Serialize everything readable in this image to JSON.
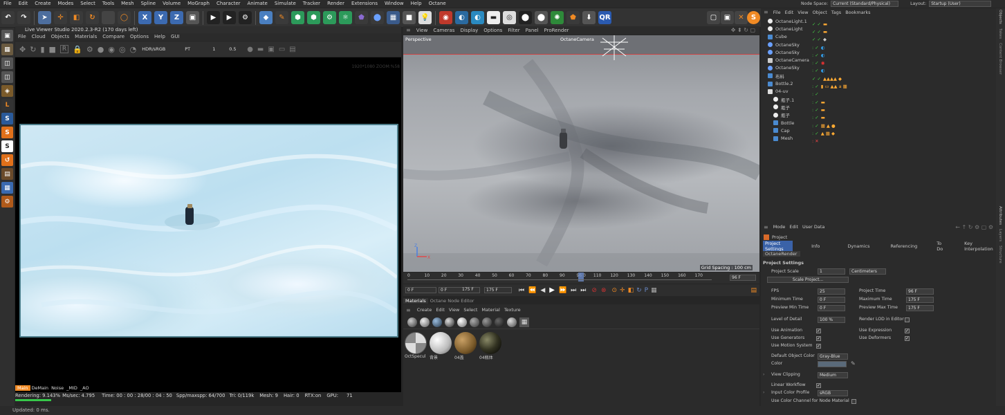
{
  "menubar": {
    "items": [
      "File",
      "Edit",
      "Create",
      "Modes",
      "Select",
      "Tools",
      "Mesh",
      "Spline",
      "Volume",
      "MoGraph",
      "Character",
      "Animate",
      "Simulate",
      "Tracker",
      "Render",
      "Extensions",
      "Window",
      "Help",
      "Octane"
    ]
  },
  "nodespace": {
    "label": "Node Space:",
    "value": "Current (Standard/Physical)",
    "layout_label": "Layout:",
    "layout_value": "Startup (User)"
  },
  "live_viewer": {
    "title": "Live Viewer Studio 2020.2.3-R2 (170 days left)",
    "menu": [
      "File",
      "Cloud",
      "Objects",
      "Materials",
      "Compare",
      "Options",
      "Help",
      "GUI"
    ],
    "color_space": "HDR/sRGB",
    "kernel": "PT",
    "value1": "1",
    "value2": "0.5",
    "resolution": "1920*1080 ZOOM:%58",
    "passes": [
      "Main",
      "DeMain",
      "Noise",
      "_MID",
      "_AO"
    ],
    "render_stats": {
      "rendering": "Rendering: 9.143%",
      "mssec": "Ms/sec: 4.795",
      "time": "Time: 00 : 00 : 28/00 : 04 : 50",
      "spp": "Spp/maxspp: 64/700",
      "tri": "Tri: 0/119k",
      "mesh": "Mesh: 9",
      "hair": "Hair: 0",
      "rtx": "RTX:on",
      "gpu": "GPU:",
      "gpu_val": "71"
    },
    "progress": 0.09143
  },
  "viewport": {
    "menu": [
      "View",
      "Cameras",
      "Display",
      "Options",
      "Filter",
      "Panel",
      "ProRender"
    ],
    "label": "Perspective",
    "camera": "OctaneCamera",
    "grid": "Grid Spacing : 100 cm"
  },
  "timeline": {
    "ticks": [
      "0",
      "10",
      "20",
      "30",
      "40",
      "50",
      "60",
      "70",
      "80",
      "90",
      "96 0",
      "110",
      "120",
      "130",
      "140",
      "150",
      "160",
      "170"
    ],
    "current": "96 F",
    "start": "0 F",
    "start2": "0 F",
    "end": "175 F",
    "end2": "175 F"
  },
  "materials": {
    "tabs": [
      "Materials",
      "Octane Node Editor"
    ],
    "menu": [
      "Create",
      "Edit",
      "View",
      "Select",
      "Material",
      "Texture"
    ],
    "items": [
      "OctSpecul",
      "背景",
      "04盖",
      "04瓶体"
    ]
  },
  "object_manager": {
    "menu": [
      "File",
      "Edit",
      "View",
      "Object",
      "Tags",
      "Bookmarks"
    ],
    "objects": [
      "OctaneLight.1",
      "OctaneLight",
      "Cube",
      "OctaneSky",
      "OctaneSky",
      "OctaneCamera",
      "OctaneSky",
      "布料",
      "Bottle.2",
      "04-uv",
      "瓶子.1",
      "瓶子",
      "瓶子",
      "Bottle",
      "Cap",
      "Mesh"
    ]
  },
  "attributes": {
    "menu": [
      "Mode",
      "Edit",
      "User Data"
    ],
    "object": "Project",
    "tabs": [
      "Project Settings",
      "Info",
      "Dynamics",
      "Referencing",
      "To Do",
      "Key Interpolation"
    ],
    "tab2": "OctaneRender",
    "section": "Project Settings",
    "project_scale_label": "Project Scale",
    "project_scale": "1",
    "units": "Centimeters",
    "scale_button": "Scale Project...",
    "fps_label": "FPS",
    "fps": "25",
    "project_time_label": "Project Time",
    "project_time": "96 F",
    "min_time_label": "Minimum Time",
    "min_time": "0 F",
    "max_time_label": "Maximum Time",
    "max_time": "175 F",
    "prev_min_label": "Preview Min Time",
    "prev_min": "0 F",
    "prev_max_label": "Preview Max Time",
    "prev_max": "175 F",
    "lod_label": "Level of Detail",
    "lod": "100 %",
    "render_lod_label": "Render LOD in Editor",
    "use_anim": "Use Animation",
    "use_expr": "Use Expression",
    "use_gen": "Use Generators",
    "use_def": "Use Deformers",
    "use_motion": "Use Motion System",
    "def_color_label": "Default Object Color",
    "def_color": "Gray-Blue",
    "color_label": "Color",
    "view_clip_label": "View Clipping",
    "view_clip": "Medium",
    "linear_label": "Linear Workflow",
    "icp_label": "Input Color Profile",
    "icp": "sRGB",
    "ucc_label": "Use Color Channel for Node Material"
  },
  "right_tabs": [
    "Objects",
    "Takes",
    "Content Browser",
    "Attributes",
    "Layers",
    "Structure"
  ],
  "status": "Updated: 0 ms."
}
